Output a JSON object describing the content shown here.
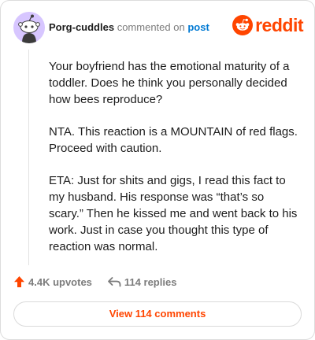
{
  "comment": {
    "author": "Porg-cuddles",
    "action_text": "commented on",
    "target_link": "post",
    "paragraphs": [
      "Your boyfriend has the emotional maturity of a toddler. Does he think you personally decided how bees reproduce?",
      "NTA. This reaction is a MOUNTAIN of red flags. Proceed with caution.",
      "ETA: Just for shits and gigs, I read this fact to my husband. His response was “that’s so scary.” Then he kissed me and went back to his work. Just in case you thought this type of reaction was normal."
    ],
    "upvotes_label": "4.4K upvotes",
    "replies_label": "114 replies"
  },
  "brand": {
    "wordmark": "reddit",
    "color": "#ff4500"
  },
  "footer": {
    "view_comments_label": "View 114 comments"
  },
  "icons": {
    "avatar": "snoo-avatar-icon",
    "logo": "reddit-logo-icon",
    "upvote": "upvote-arrow-icon",
    "reply": "reply-arrow-icon"
  }
}
